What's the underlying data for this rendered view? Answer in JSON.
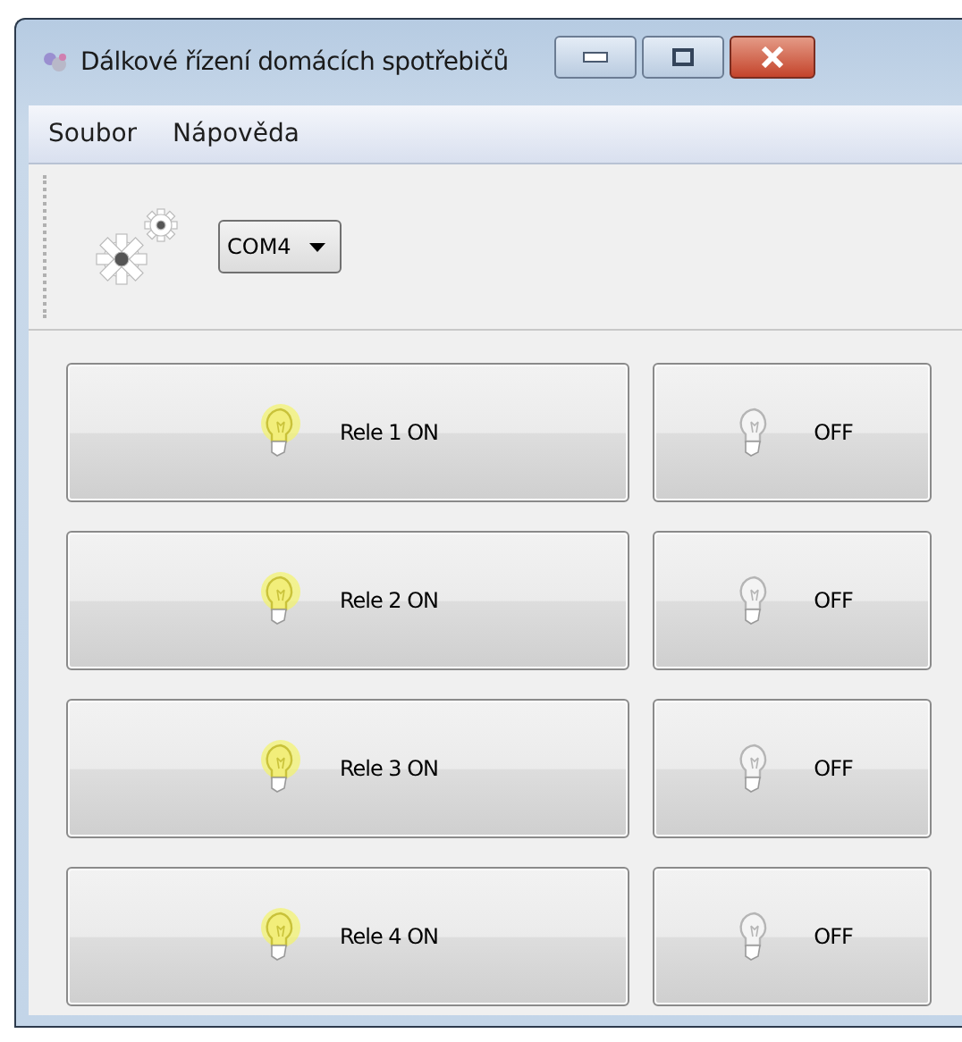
{
  "window": {
    "title": "Dálkové řízení domácích spotřebičů"
  },
  "menu": [
    {
      "label": "Soubor"
    },
    {
      "label": "Nápověda"
    }
  ],
  "toolbar": {
    "port": {
      "value": "COM4"
    }
  },
  "relays": [
    {
      "buttons": [
        {
          "kind": "on",
          "label": "Rele 1 ON"
        },
        {
          "kind": "off",
          "label": "OFF"
        }
      ]
    },
    {
      "buttons": [
        {
          "kind": "on",
          "label": "Rele 2 ON"
        },
        {
          "kind": "off",
          "label": "OFF"
        }
      ]
    },
    {
      "buttons": [
        {
          "kind": "on",
          "label": "Rele 3 ON"
        },
        {
          "kind": "off",
          "label": "OFF"
        }
      ]
    },
    {
      "buttons": [
        {
          "kind": "on",
          "label": "Rele 4 ON"
        },
        {
          "kind": "off",
          "label": "OFF"
        }
      ]
    }
  ]
}
